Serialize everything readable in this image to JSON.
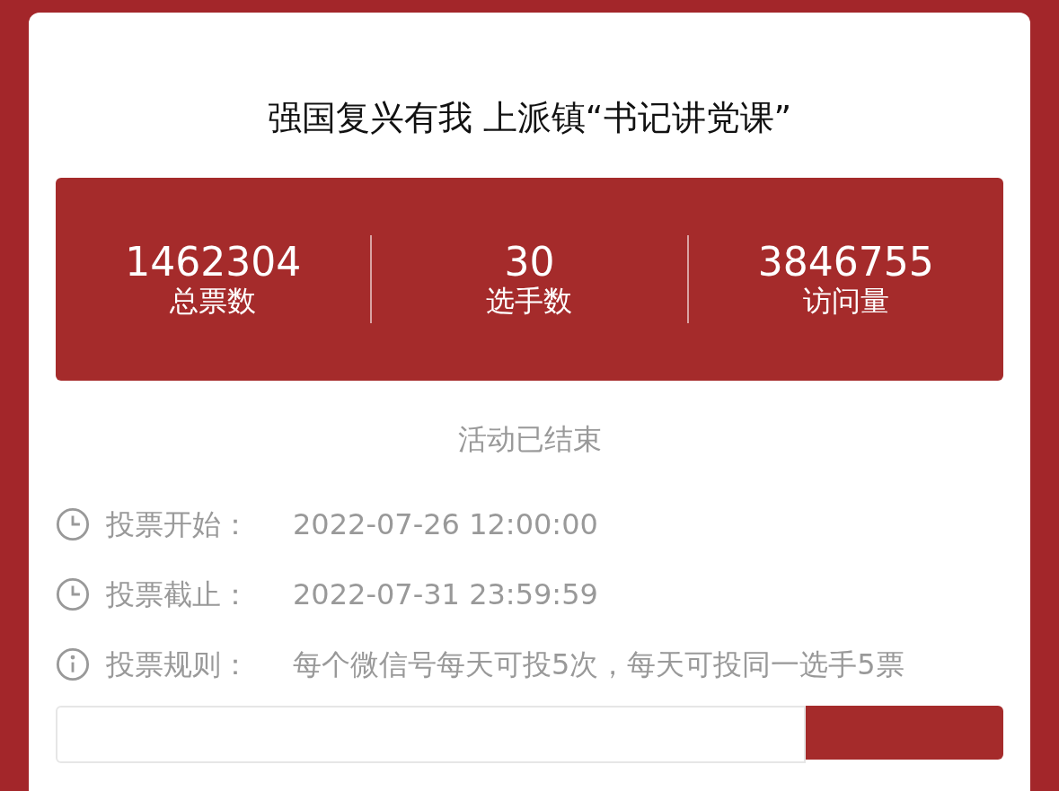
{
  "title": "强国复兴有我 上派镇“书记讲党课”",
  "stats": [
    {
      "value": "1462304",
      "label": "总票数"
    },
    {
      "value": "30",
      "label": "选手数"
    },
    {
      "value": "3846755",
      "label": "访问量"
    }
  ],
  "status": "活动已结束",
  "info": [
    {
      "kind": "clock",
      "label": "投票开始：",
      "value": "2022-07-26 12:00:00"
    },
    {
      "kind": "clock",
      "label": "投票截止：",
      "value": "2022-07-31 23:59:59"
    },
    {
      "kind": "info",
      "label": "投票规则：",
      "value": "每个微信号每天可投5次，每天可投同一选手5票"
    }
  ]
}
